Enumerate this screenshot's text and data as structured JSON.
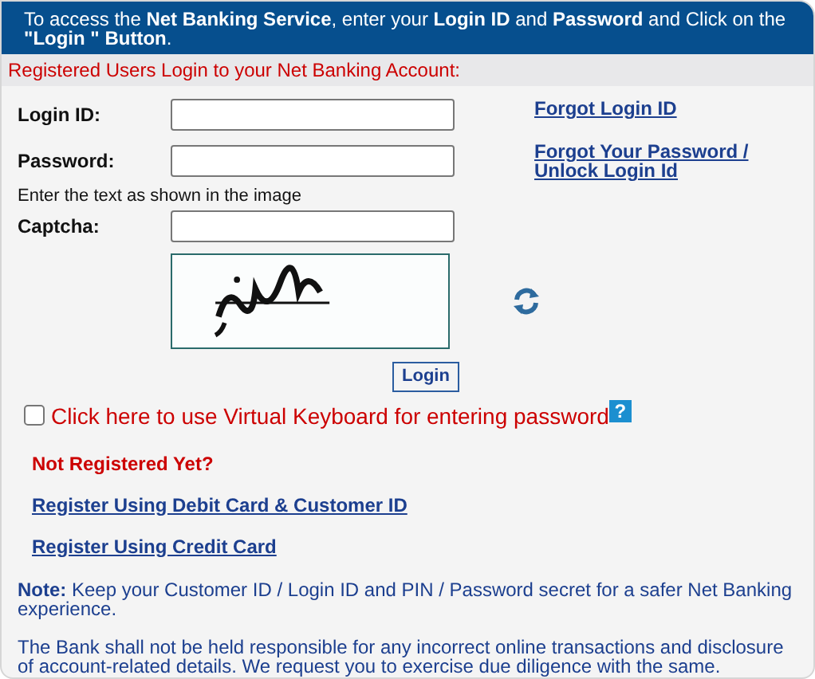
{
  "header": {
    "text": "To access the **Net Banking Service**, enter your **Login ID** and **Password** and Click on the **\"Login \" Button**."
  },
  "section_title": "Registered Users Login to your Net Banking Account:",
  "fields": [
    {
      "label": "Login ID:"
    },
    {
      "label": "Password:"
    }
  ],
  "forgot_links": [
    "Forgot Login ID",
    "Forgot Your Password / Unlock Login Id"
  ],
  "captcha_hint": "Enter the text as shown in the image",
  "captcha": {
    "label": "Captcha:"
  },
  "login_button": "Login",
  "virtual_keyboard": {
    "label": "Click here to use Virtual Keyboard for entering password",
    "checked": false,
    "help": "?"
  },
  "not_registered": "Not Registered Yet?",
  "register_links": [
    "Register Using Debit Card & Customer ID",
    "Register Using Credit Card"
  ],
  "note": "**Note:** Keep your Customer ID / Login ID and PIN / Password secret for a safer Net Banking experience.",
  "disclaimer": "The Bank shall not be held responsible for any incorrect online transactions and disclosure of account-related details. We request you to exercise due diligence with the same."
}
